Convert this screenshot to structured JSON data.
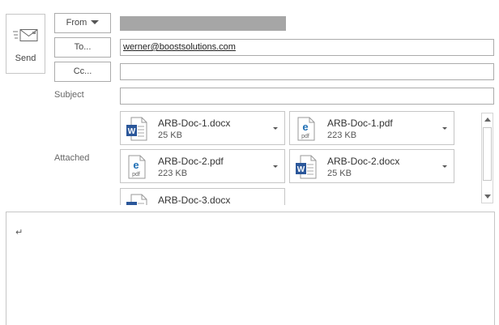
{
  "send": {
    "label": "Send",
    "icon": "send-envelope-icon"
  },
  "fields": {
    "from_label": "From",
    "to_label": "To...",
    "cc_label": "Cc...",
    "subject_label": "Subject",
    "attached_label": "Attached"
  },
  "to_value": "werner@boostsolutions.com",
  "cc_value": "",
  "subject_value": "",
  "attachments": [
    {
      "name": "ARB-Doc-1.docx",
      "size": "25 KB",
      "icon": "word-icon"
    },
    {
      "name": "ARB-Doc-1.pdf",
      "size": "223 KB",
      "icon": "pdf-icon"
    },
    {
      "name": "ARB-Doc-2.pdf",
      "size": "223 KB",
      "icon": "pdf-icon"
    },
    {
      "name": "ARB-Doc-2.docx",
      "size": "25 KB",
      "icon": "word-icon"
    },
    {
      "name": "ARB-Doc-3.docx",
      "size": "",
      "icon": "word-icon"
    }
  ],
  "body": {
    "paragraph_mark": "↵"
  },
  "colors": {
    "word_blue": "#2b579a",
    "pdf_blue": "#1f6fb5",
    "border": "#ababab"
  }
}
